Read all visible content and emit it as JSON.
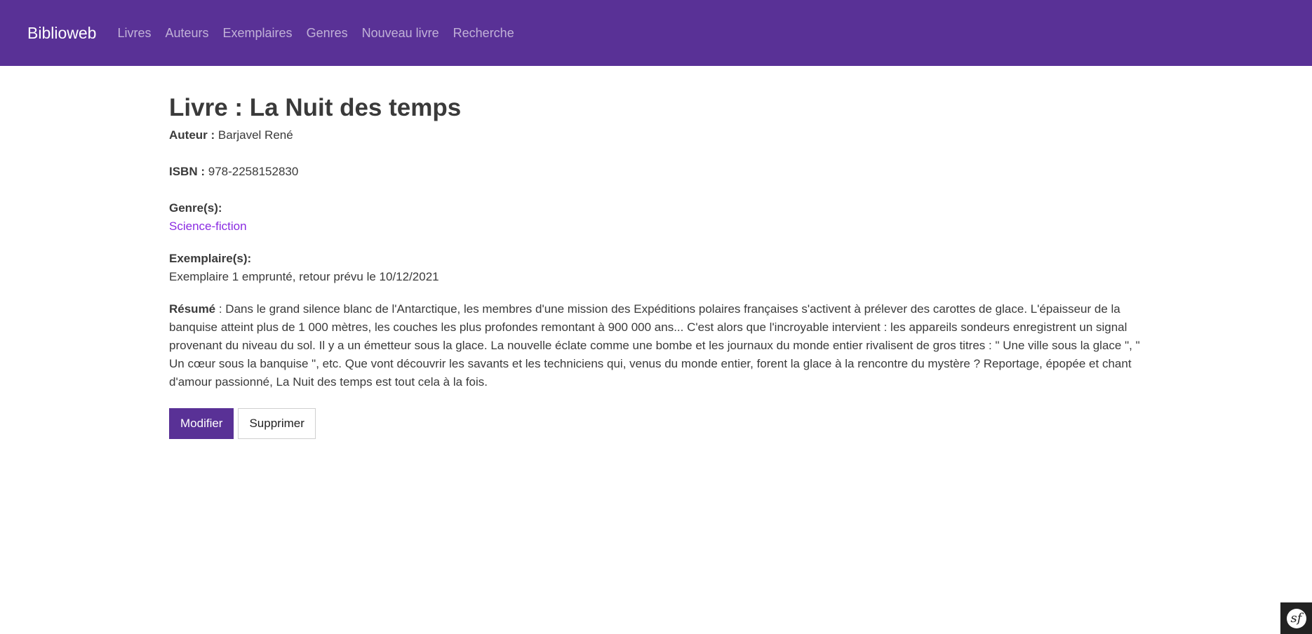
{
  "nav": {
    "brand": "Biblioweb",
    "links": [
      "Livres",
      "Auteurs",
      "Exemplaires",
      "Genres",
      "Nouveau livre",
      "Recherche"
    ]
  },
  "book": {
    "title": "Livre : La Nuit des temps",
    "author_label": "Auteur :",
    "author": "Barjavel René",
    "isbn_label": "ISBN :",
    "isbn": "978-2258152830",
    "genres_label": "Genre(s):",
    "genres": [
      "Science-fiction"
    ],
    "copies_label": "Exemplaire(s):",
    "copies": [
      "Exemplaire 1 emprunté, retour prévu le 10/12/2021"
    ],
    "summary_label": "Résumé",
    "summary": " : Dans le grand silence blanc de l'Antarctique, les membres d'une mission des Expéditions polaires françaises s'activent à prélever des carottes de glace. L'épaisseur de la banquise atteint plus de 1 000 mètres, les couches les plus profondes remontant à 900 000 ans... C'est alors que l'incroyable intervient : les appareils sondeurs enregistrent un signal provenant du niveau du sol. Il y a un émetteur sous la glace. La nouvelle éclate comme une bombe et les journaux du monde entier rivalisent de gros titres : \" Une ville sous la glace \", \" Un cœur sous la banquise \", etc. Que vont découvrir les savants et les techniciens qui, venus du monde entier, forent la glace à la rencontre du mystère ? Reportage, épopée et chant d'amour passionné, La Nuit des temps est tout cela à la fois."
  },
  "actions": {
    "edit": "Modifier",
    "delete": "Supprimer"
  },
  "toolbar": {
    "icon": "symfony-icon",
    "glyph": "sf"
  },
  "colors": {
    "navbar": "#593196",
    "link": "#8a2be2"
  }
}
